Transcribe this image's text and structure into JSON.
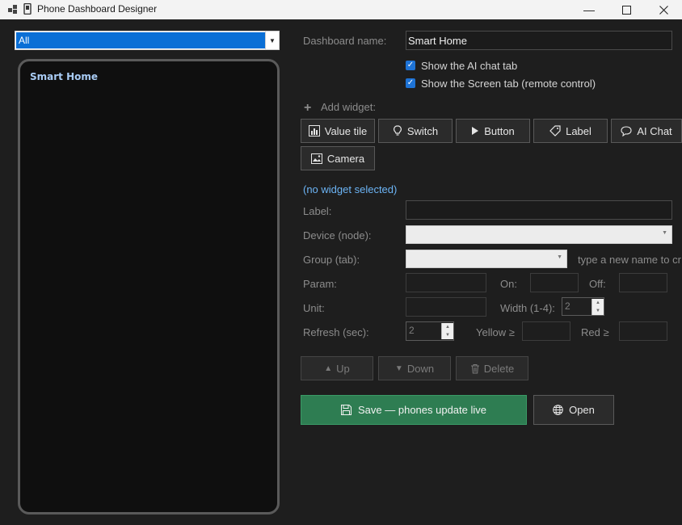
{
  "window": {
    "title": "Phone Dashboard Designer"
  },
  "filter": {
    "selected": "All"
  },
  "phone_preview": {
    "title": "Smart Home"
  },
  "form": {
    "dashboard_name_label": "Dashboard name:",
    "dashboard_name_value": "Smart Home",
    "show_ai_chat_label": "Show the AI chat tab",
    "show_ai_chat_checked": true,
    "show_screen_label": "Show the Screen tab (remote control)",
    "show_screen_checked": true,
    "add_widget_label": "Add widget:"
  },
  "widget_buttons": [
    {
      "label": "Value tile",
      "icon": "bar-chart-icon"
    },
    {
      "label": "Switch",
      "icon": "lightbulb-icon"
    },
    {
      "label": "Button",
      "icon": "play-icon"
    },
    {
      "label": "Label",
      "icon": "tag-icon"
    },
    {
      "label": "AI Chat",
      "icon": "chat-bubble-icon"
    },
    {
      "label": "Camera",
      "icon": "image-icon"
    }
  ],
  "editor": {
    "no_selection": "(no widget selected)",
    "label_label": "Label:",
    "device_label": "Device (node):",
    "group_label": "Group (tab):",
    "group_hint": "type a new name to cr",
    "param_label": "Param:",
    "on_label": "On:",
    "off_label": "Off:",
    "unit_label": "Unit:",
    "width_label": "Width (1-4):",
    "width_value": "2",
    "refresh_label": "Refresh (sec):",
    "refresh_value": "2",
    "yellow_label": "Yellow ≥",
    "red_label": "Red ≥"
  },
  "order_buttons": {
    "up": "Up",
    "down": "Down",
    "delete": "Delete"
  },
  "actions": {
    "save": "Save — phones update live",
    "open": "Open"
  },
  "colors": {
    "accent": "#0a6fd6",
    "save_green": "#2e7d52",
    "link": "#6cb4f5",
    "phone_title": "#a9ccf5"
  }
}
